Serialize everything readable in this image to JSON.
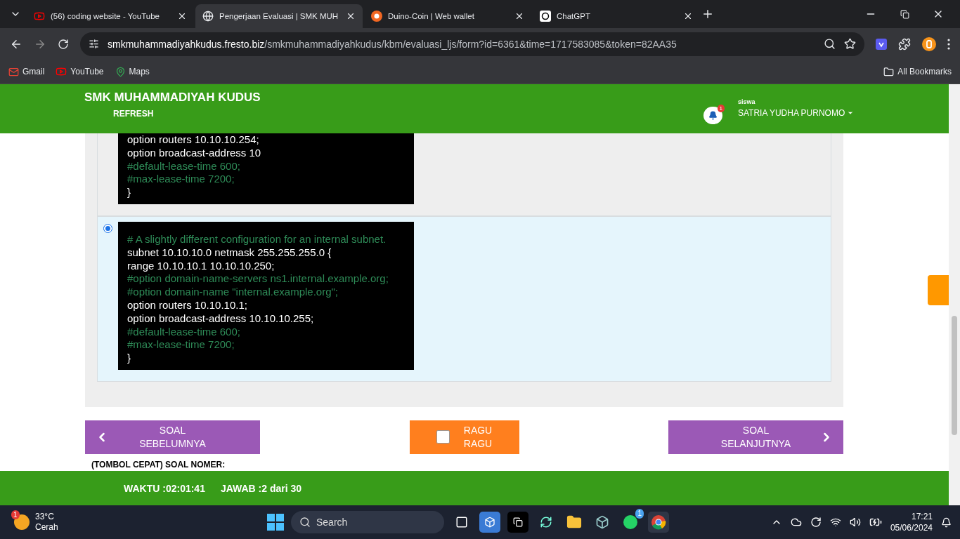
{
  "browser": {
    "tabs": [
      {
        "title": "(56) coding website - YouTube",
        "selected": false
      },
      {
        "title": "Pengerjaan Evaluasi | SMK MUH",
        "selected": true
      },
      {
        "title": "Duino-Coin | Web wallet",
        "selected": false
      },
      {
        "title": "ChatGPT",
        "selected": false
      }
    ],
    "url_host": "smkmuhammadiyahkudus.fresto.biz",
    "url_path": "/smkmuhammadiyahkudus/kbm/evaluasi_ljs/form?id=6361&time=1717583085&token=82AA35",
    "bookmarks": [
      {
        "label": "Gmail"
      },
      {
        "label": "YouTube"
      },
      {
        "label": "Maps"
      }
    ],
    "all_bookmarks": "All Bookmarks"
  },
  "header": {
    "school": "SMK MUHAMMADIYAH KUDUS",
    "refresh": "REFRESH",
    "notification_count": "1",
    "role": "siswa",
    "user": "SATRIA YUDHA PURNOMO"
  },
  "options": [
    {
      "lines": [
        {
          "text": "option routers 10.10.10.254;",
          "kind": "code"
        },
        {
          "text": "option broadcast-address 10",
          "kind": "code"
        },
        {
          "text": "#default-lease-time 600;",
          "kind": "comment"
        },
        {
          "text": "#max-lease-time 7200;",
          "kind": "comment"
        },
        {
          "text": "}",
          "kind": "code"
        }
      ]
    },
    {
      "selected": true,
      "lines": [
        {
          "text": "# A slightly different configuration for an internal subnet.",
          "kind": "comment"
        },
        {
          "text": "subnet 10.10.10.0 netmask 255.255.255.0 {",
          "kind": "code"
        },
        {
          "text": "range 10.10.10.1 10.10.10.250;",
          "kind": "code"
        },
        {
          "text": "#option domain-name-servers ns1.internal.example.org;",
          "kind": "comment"
        },
        {
          "text": "#option domain-name \"internal.example.org\";",
          "kind": "comment"
        },
        {
          "text": "option routers 10.10.10.1;",
          "kind": "code"
        },
        {
          "text": "option broadcast-address 10.10.10.255;",
          "kind": "code"
        },
        {
          "text": "#default-lease-time 600;",
          "kind": "comment"
        },
        {
          "text": "#max-lease-time 7200;",
          "kind": "comment"
        },
        {
          "text": "}",
          "kind": "code"
        }
      ]
    }
  ],
  "nav": {
    "previous": [
      "SOAL",
      "SEBELUMNYA"
    ],
    "doubt": {
      "label": [
        "RAGU",
        "RAGU"
      ],
      "checked": false
    },
    "next": [
      "SOAL",
      "SELANJUTNYA"
    ]
  },
  "quick_buttons_label": "(TOMBOL CEPAT) SOAL NOMER:",
  "footer": {
    "time_label": "WAKTU :",
    "time": "02:01:41",
    "answered_label": "JAWAB :",
    "answered": "2",
    "answered_total": "dari 30"
  },
  "taskbar": {
    "weather_badge": "1",
    "temperature": "33°C",
    "condition": "Cerah",
    "search": "Search",
    "whatsapp_badge": "1",
    "time": "17:21",
    "date": "05/06/2024"
  }
}
